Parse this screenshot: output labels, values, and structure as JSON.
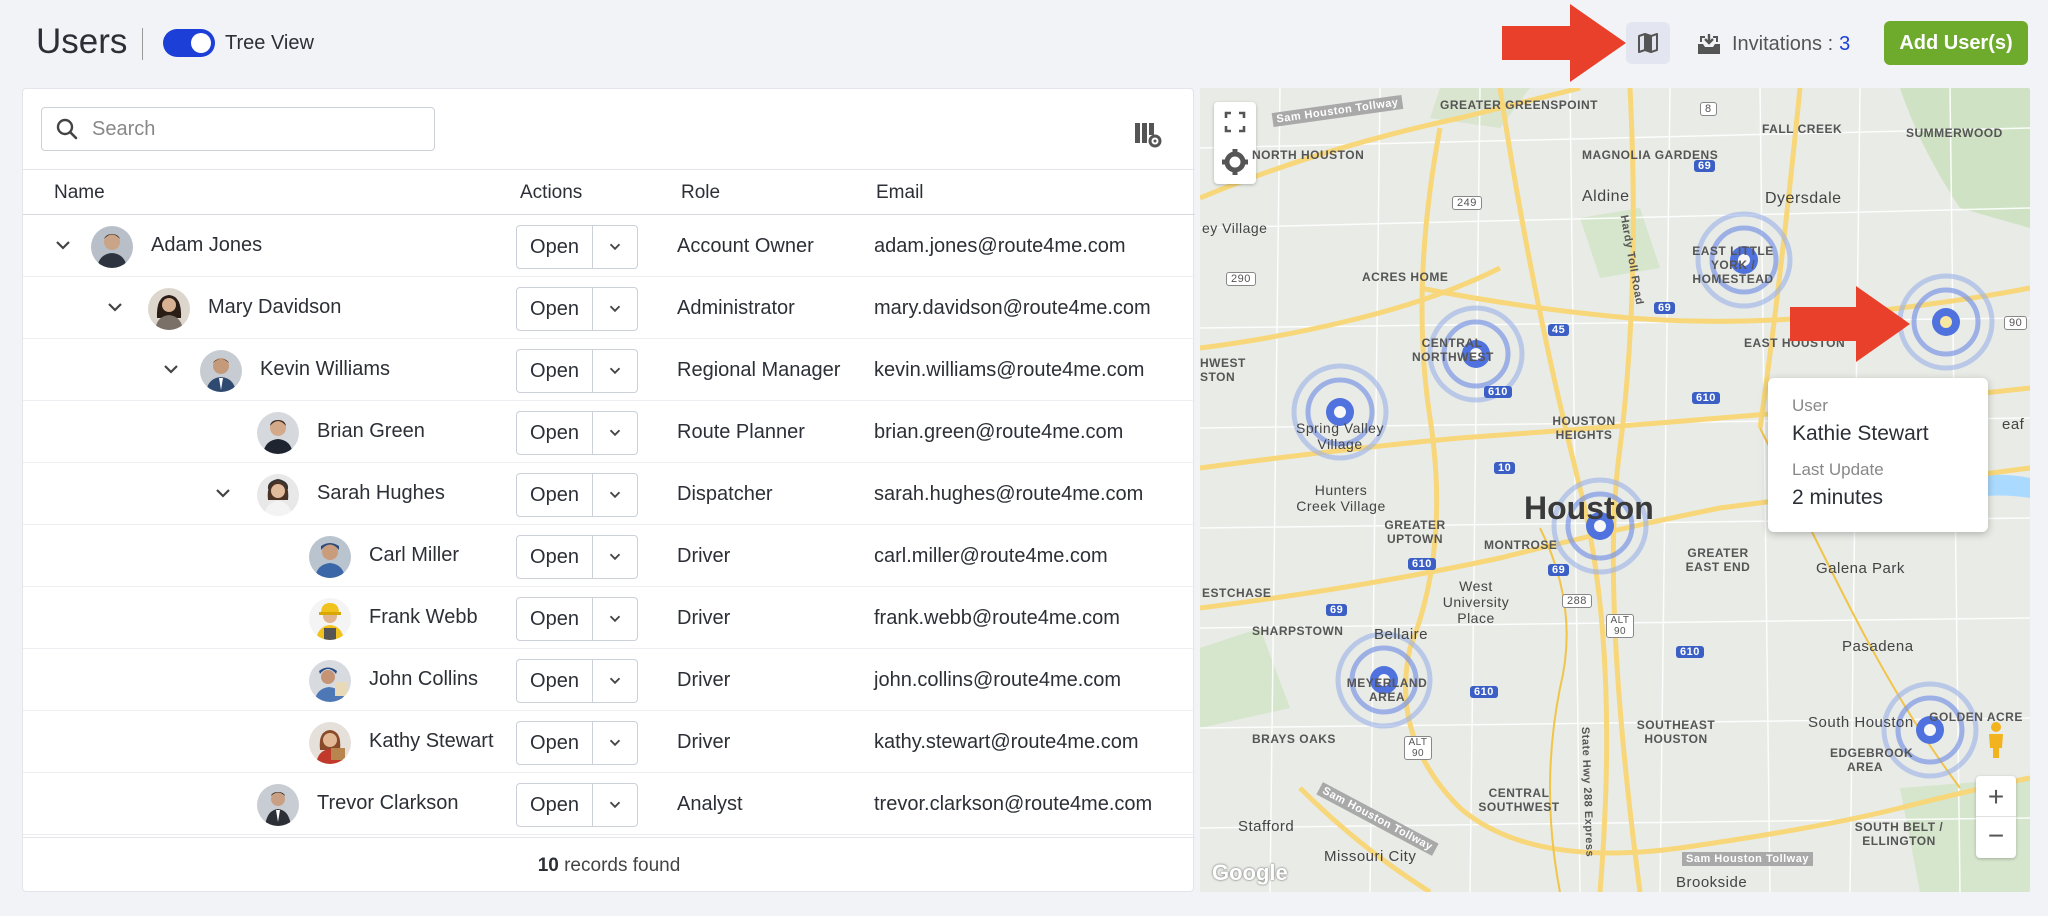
{
  "header": {
    "title": "Users",
    "toggle_label": "Tree View",
    "invitations_label": "Invitations :",
    "invitations_count": "3",
    "add_button": "Add User(s)"
  },
  "icons": {
    "map": "map-icon",
    "invitations": "inbox-icon",
    "search": "search-icon",
    "column_settings": "column-settings-icon",
    "chevron": "chevron-down-icon"
  },
  "colors": {
    "accent": "#1c3fd8",
    "add_button": "#6eaa2c",
    "arrow": "#e8402a"
  },
  "table": {
    "search_placeholder": "Search",
    "columns": [
      "Name",
      "Actions",
      "Role",
      "Email"
    ],
    "open_label": "Open",
    "rows": [
      {
        "name": "Adam Jones",
        "role": "Account Owner",
        "email": "adam.jones@route4me.com"
      },
      {
        "name": "Mary Davidson",
        "role": "Administrator",
        "email": "mary.davidson@route4me.com"
      },
      {
        "name": "Kevin Williams",
        "role": "Regional Manager",
        "email": "kevin.williams@route4me.com"
      },
      {
        "name": "Brian Green",
        "role": "Route Planner",
        "email": "brian.green@route4me.com"
      },
      {
        "name": "Sarah Hughes",
        "role": "Dispatcher",
        "email": "sarah.hughes@route4me.com"
      },
      {
        "name": "Carl Miller",
        "role": "Driver",
        "email": "carl.miller@route4me.com"
      },
      {
        "name": "Frank Webb",
        "role": "Driver",
        "email": "frank.webb@route4me.com"
      },
      {
        "name": "John Collins",
        "role": "Driver",
        "email": "john.collins@route4me.com"
      },
      {
        "name": "Kathy Stewart",
        "role": "Driver",
        "email": "kathy.stewart@route4me.com"
      },
      {
        "name": "Trevor Clarkson",
        "role": "Analyst",
        "email": "trevor.clarkson@route4me.com"
      }
    ],
    "records_count": "10",
    "records_label": "records found"
  },
  "map": {
    "city_label": "Houston",
    "places": [
      "GREATER GREENSPOINT",
      "Aldine",
      "FALL CREEK",
      "SUMMERWOOD",
      "NORTH HOUSTON",
      "MAGNOLIA GARDENS",
      "Dyersdale",
      "ey Village",
      "ACRES HOME",
      "EAST LITTLE YORK / HOMESTEAD",
      "CENTRAL NORTHWEST",
      "EAST HOUSTON",
      "HWEST STON",
      "Spring Valley Village",
      "HOUSTON HEIGHTS",
      "Hunters Creek Village",
      "GREATER UPTOWN",
      "MONTROSE",
      "GREATER EAST END",
      "Galena Park",
      "ESTCHASE",
      "West University Place",
      "SHARPSTOWN",
      "Bellaire",
      "Pasadena",
      "MEYERLAND AREA",
      "SOUTHEAST HOUSTON",
      "South Houston",
      "GOLDEN ACRE",
      "BRAYS OAKS",
      "EDGEBROOK AREA",
      "CENTRAL SOUTHWEST",
      "SOUTH BELT / ELLINGTON",
      "Stafford",
      "Missouri City",
      "Brookside",
      "eaf"
    ],
    "roads": [
      "Sam Houston Tollway",
      "Hardy Toll Road",
      "State Hwy 288 Express"
    ],
    "route_shields": [
      "8",
      "249",
      "290",
      "69",
      "45",
      "610",
      "10",
      "90",
      "288",
      "ALT 90",
      "ALT 90"
    ],
    "tooltip": {
      "user_label": "User",
      "user_name": "Kathie Stewart",
      "update_label": "Last Update",
      "update_value": "2 minutes"
    },
    "zoom_in": "+",
    "zoom_out": "−",
    "attribution": "Google"
  }
}
